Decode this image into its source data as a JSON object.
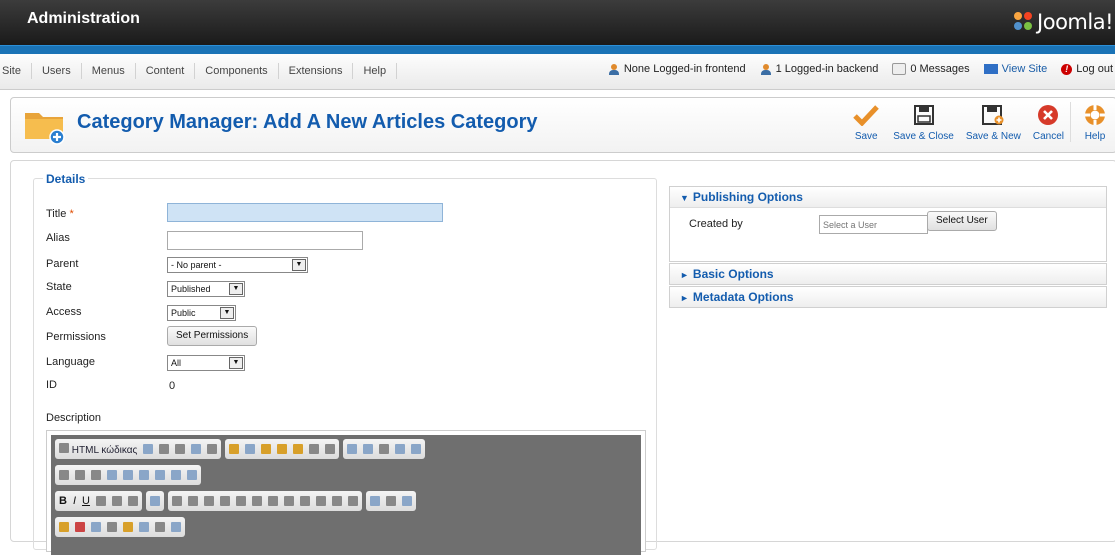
{
  "header": {
    "title": "Administration",
    "logo_text": "Joomla!"
  },
  "menu": {
    "items": [
      "Site",
      "Users",
      "Menus",
      "Content",
      "Components",
      "Extensions",
      "Help"
    ]
  },
  "status": {
    "frontend": "None Logged-in frontend",
    "backend": "1 Logged-in backend",
    "messages": "0 Messages",
    "view_site": "View Site",
    "logout": "Log out"
  },
  "toolbar": {
    "title": "Category Manager: Add A New Articles Category",
    "buttons": {
      "save": "Save",
      "save_close": "Save & Close",
      "save_new": "Save & New",
      "cancel": "Cancel",
      "help": "Help"
    }
  },
  "details": {
    "legend": "Details",
    "labels": {
      "title": "Title",
      "required_mark": "*",
      "alias": "Alias",
      "parent": "Parent",
      "state": "State",
      "access": "Access",
      "permissions": "Permissions",
      "language": "Language",
      "id": "ID",
      "description": "Description"
    },
    "values": {
      "title": "",
      "alias": "",
      "parent": "- No parent -",
      "state": "Published",
      "access": "Public",
      "language": "All",
      "id": "0",
      "permissions_button": "Set Permissions"
    }
  },
  "editor": {
    "html_source_label": "HTML κώδικας",
    "bold": "B",
    "italic": "I",
    "underline": "U"
  },
  "right_panel": {
    "publishing": {
      "title": "Publishing Options",
      "created_by_label": "Created by",
      "user_placeholder": "Select a User",
      "select_user_button": "Select User"
    },
    "basic": {
      "title": "Basic Options"
    },
    "metadata": {
      "title": "Metadata Options"
    }
  },
  "colors": {
    "accent": "#135cae",
    "header_bg": "#1a1a1a",
    "header_line": "#1a73b6",
    "active_field": "#cfe3f5"
  }
}
